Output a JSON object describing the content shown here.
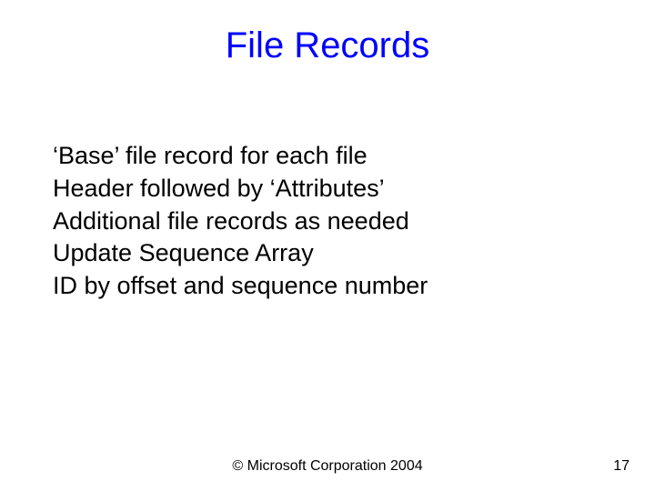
{
  "slide": {
    "title": "File Records",
    "bullets": [
      "‘Base’ file record for each file",
      "Header followed by ‘Attributes’",
      "Additional file records as needed",
      "Update Sequence Array",
      "ID by offset and sequence number"
    ],
    "footer": "© Microsoft Corporation 2004",
    "page_number": "17"
  }
}
